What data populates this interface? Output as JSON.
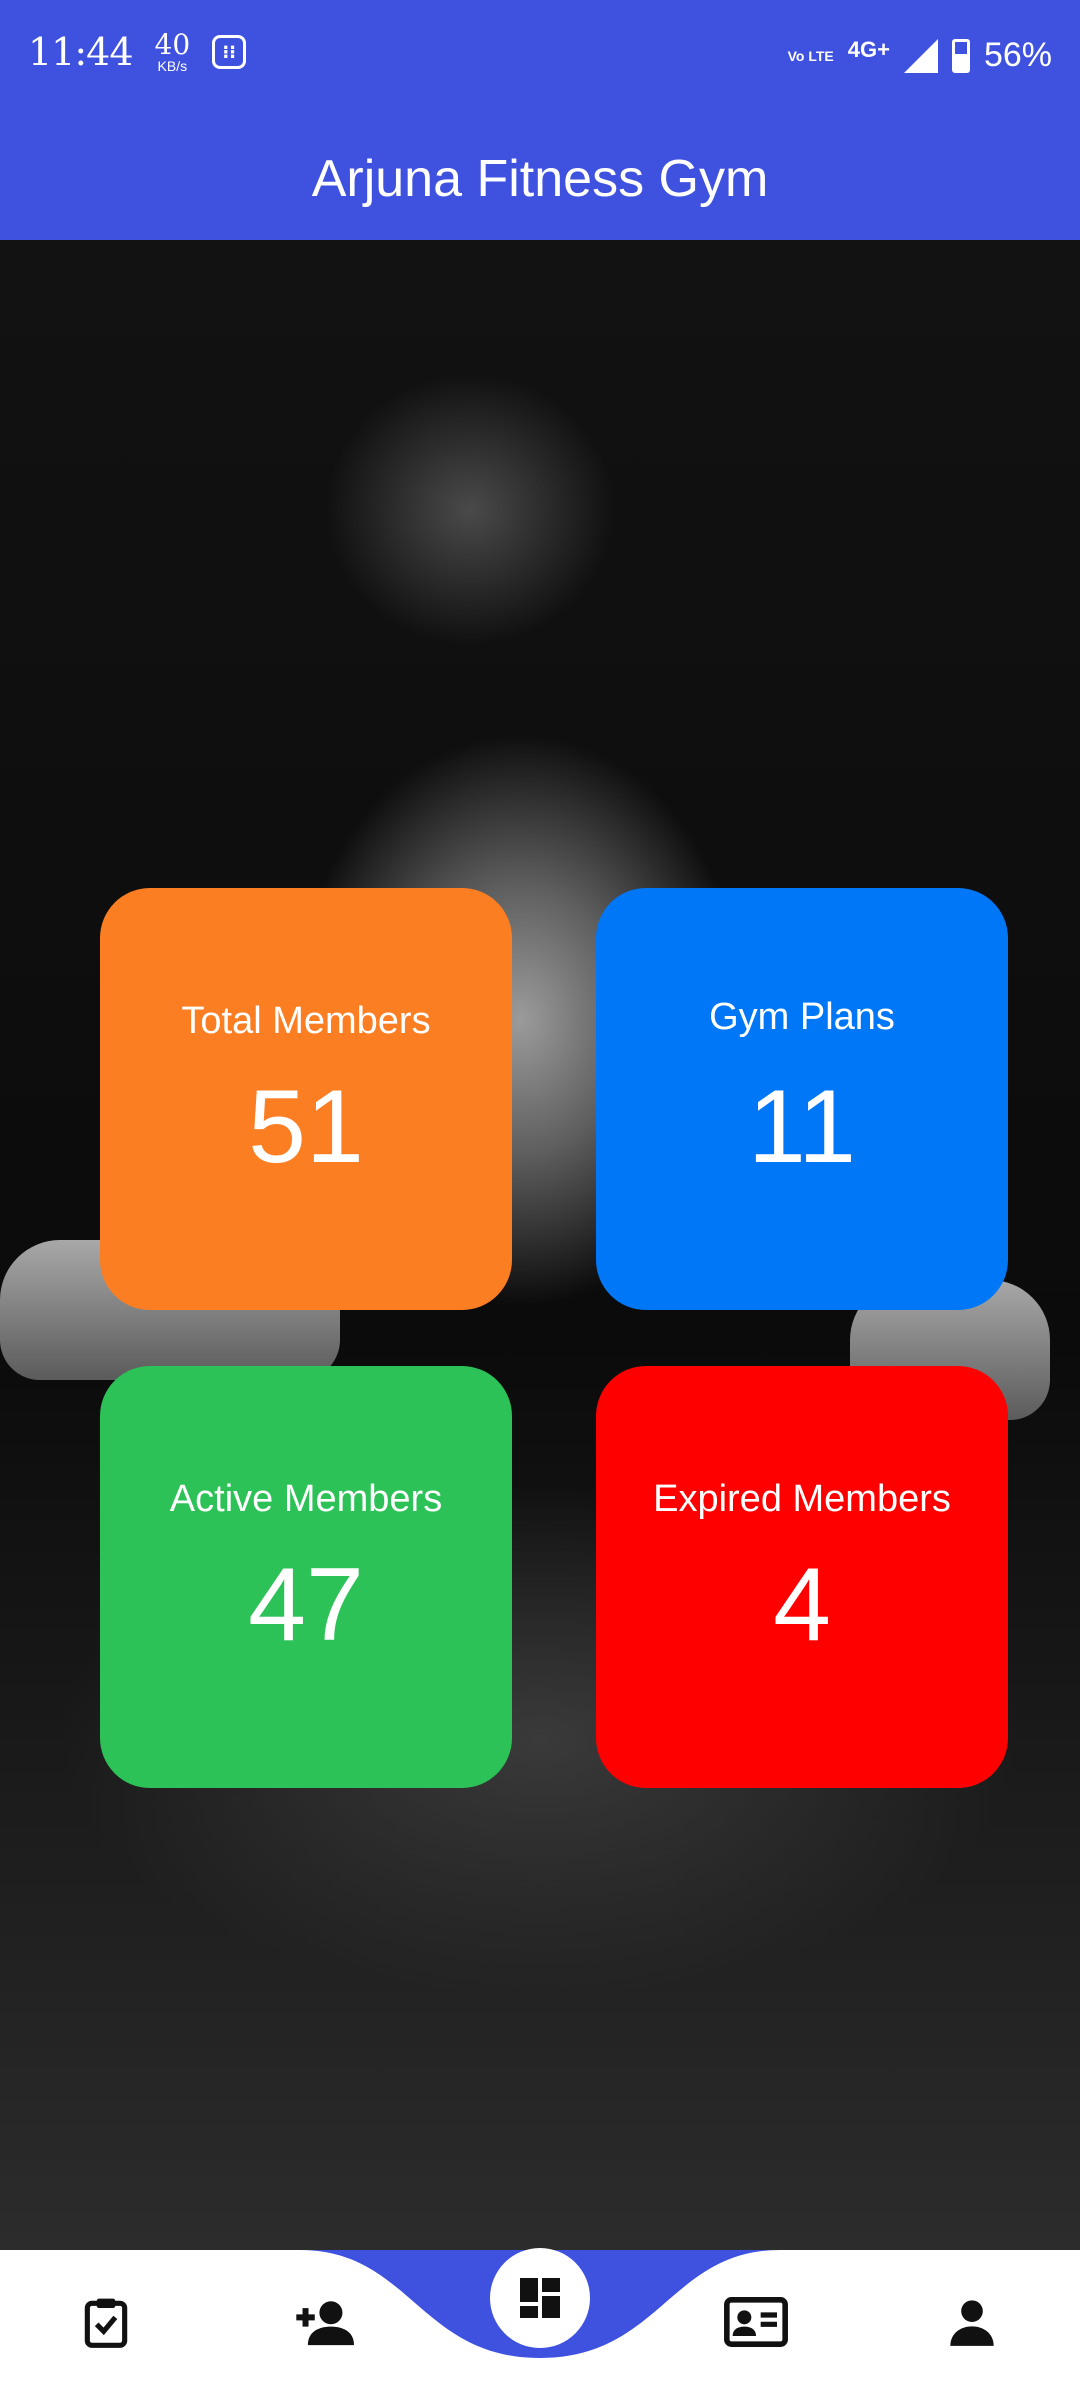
{
  "status_bar": {
    "time": "11:44",
    "net_speed_value": "40",
    "net_speed_unit": "KB/s",
    "volte": "Vo LTE",
    "network": "4G+",
    "battery": "56%"
  },
  "app": {
    "title": "Arjuna Fitness Gym"
  },
  "stats": [
    {
      "label": "Total Members",
      "value": "51",
      "color": "#fb7e23"
    },
    {
      "label": "Gym Plans",
      "value": "11",
      "color": "#0077f7"
    },
    {
      "label": "Active Members",
      "value": "47",
      "color": "#2dc257"
    },
    {
      "label": "Expired Members",
      "value": "4",
      "color": "#ff0000"
    }
  ],
  "bottom_nav": {
    "items": [
      {
        "icon": "clipboard-check-icon"
      },
      {
        "icon": "add-person-icon"
      },
      {
        "icon": "dashboard-icon",
        "active": true
      },
      {
        "icon": "id-card-icon"
      },
      {
        "icon": "person-icon"
      }
    ],
    "accent": "#3f51df"
  }
}
